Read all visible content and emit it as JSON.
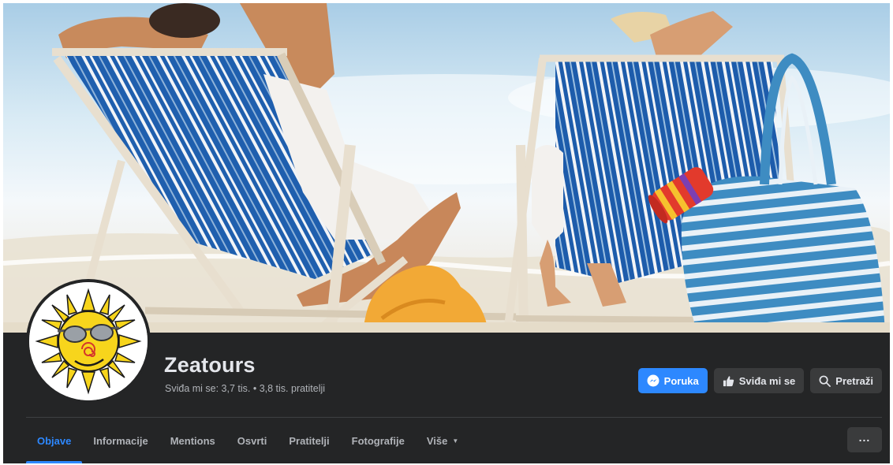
{
  "page": {
    "name": "Zeatours",
    "stats": "Sviđa mi se: 3,7 tis. • 3,8 tis. pratitelji"
  },
  "actions": {
    "message_label": "Poruka",
    "like_label": "Sviđa mi se",
    "search_label": "Pretraži"
  },
  "tabs": [
    {
      "label": "Objave",
      "active": true
    },
    {
      "label": "Informacije",
      "active": false
    },
    {
      "label": "Mentions",
      "active": false
    },
    {
      "label": "Osvrti",
      "active": false
    },
    {
      "label": "Pratitelji",
      "active": false
    },
    {
      "label": "Fotografije",
      "active": false
    },
    {
      "label": "Više",
      "active": false
    }
  ],
  "more_menu_icon": "ellipsis-icon",
  "colors": {
    "background": "#242526",
    "accent": "#2d88ff",
    "button_secondary": "#3a3b3c",
    "text_primary": "#e4e6eb",
    "text_secondary": "#b0b3b8"
  }
}
